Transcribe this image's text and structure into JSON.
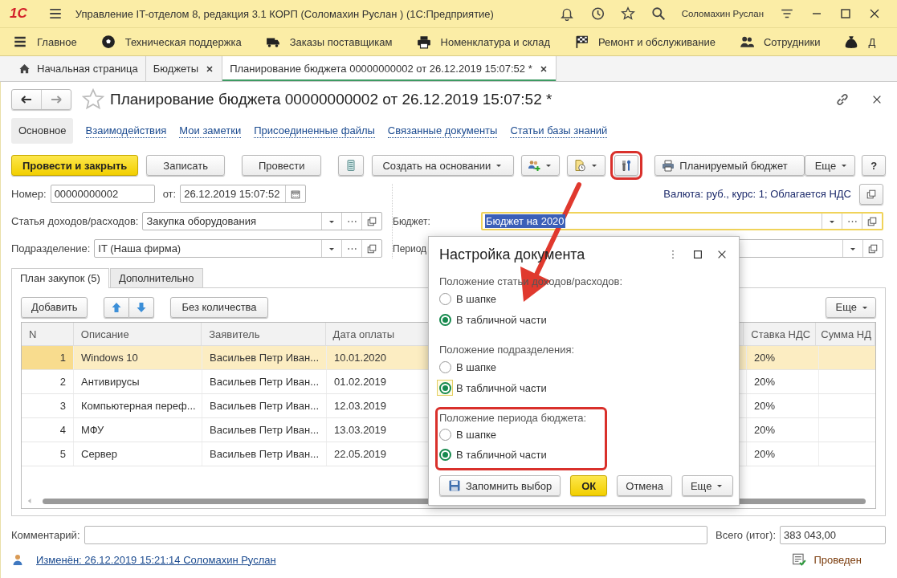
{
  "window": {
    "logo": "1С",
    "title": "Управление IT-отделом 8, редакция 3.1 КОРП (Соломахин Руслан )  (1С:Предприятие)",
    "user": "Соломахин Руслан"
  },
  "menu": [
    {
      "kind": "lines",
      "label": "Главное"
    },
    {
      "kind": "ball",
      "label": "Техническая поддержка"
    },
    {
      "kind": "truck",
      "label": "Заказы поставщикам"
    },
    {
      "kind": "printer",
      "label": "Номенклатура и склад"
    },
    {
      "kind": "flag",
      "label": "Ремонт и обслуживание"
    },
    {
      "kind": "people",
      "label": "Сотрудники"
    },
    {
      "kind": "bag",
      "label": "Д"
    }
  ],
  "tabs": [
    {
      "kind": "home",
      "label": "Начальная страница",
      "selected": false
    },
    {
      "kind": "closable",
      "label": "Бюджеты",
      "selected": false
    },
    {
      "kind": "closable",
      "label": "Планирование бюджета 00000000002 от 26.12.2019 15:07:52 *",
      "selected": true
    }
  ],
  "form": {
    "title": "Планирование бюджета 00000000002 от 26.12.2019 15:07:52 *",
    "sections": [
      {
        "label": "Основное",
        "selected": true
      },
      {
        "label": "Взаимодействия",
        "selected": false
      },
      {
        "label": "Мои заметки",
        "selected": false
      },
      {
        "label": "Присоединенные файлы",
        "selected": false
      },
      {
        "label": "Связанные документы",
        "selected": false
      },
      {
        "label": "Статьи базы знаний",
        "selected": false
      }
    ],
    "commands": [
      {
        "kind": "primary",
        "label": "Провести и закрыть",
        "highlighted": false
      },
      {
        "kind": "plain",
        "label": "Записать",
        "highlighted": false
      },
      {
        "kind": "plain",
        "label": "Провести",
        "highlighted": false
      },
      {
        "kind": "list",
        "highlighted": false
      },
      {
        "kind": "menu",
        "label": "Создать на основании",
        "highlighted": false
      },
      {
        "kind": "users",
        "highlighted": false
      },
      {
        "kind": "docs",
        "highlighted": false
      },
      {
        "kind": "tools",
        "highlighted": true
      },
      {
        "kind": "print",
        "label": "Планируемый бюджет",
        "highlighted": false
      },
      {
        "kind": "more",
        "label": "Еще",
        "highlighted": false
      },
      {
        "kind": "plain",
        "label": "?",
        "highlighted": false
      }
    ],
    "number": {
      "label": "Номер:",
      "value": "00000000002"
    },
    "date": {
      "label": "от:",
      "value": "26.12.2019 15:07:52"
    },
    "currency_note": "Валюта: руб., курс: 1; Облагается НДС",
    "item": {
      "label": "Статья доходов/расходов:",
      "value": "Закупка оборудования"
    },
    "budget": {
      "label": "Бюджет:",
      "value": "Бюджет на 2020",
      "focused": true
    },
    "department": {
      "label": "Подразделение:",
      "value": "IT (Наша фирма)"
    },
    "period": {
      "label": "Период"
    },
    "table_tabs": [
      {
        "label": "План закупок (5)",
        "selected": true
      },
      {
        "label": "Дополнительно",
        "selected": false
      }
    ],
    "table_buttons": [
      {
        "kind": "plain",
        "label": "Добавить"
      },
      {
        "kind": "up"
      },
      {
        "kind": "down"
      },
      {
        "kind": "plain",
        "label": "Без количества"
      },
      {
        "kind": "more",
        "label": "Еще"
      }
    ],
    "table": {
      "columns": [
        "N",
        "Описание",
        "Заявитель",
        "Дата оплаты",
        "Ставка НДС",
        "Сумма НД"
      ],
      "rows": [
        {
          "cells": [
            "1",
            "Windows 10",
            "Васильев Петр Иван...",
            "10.01.2020",
            "20%"
          ],
          "selected": true
        },
        {
          "cells": [
            "2",
            "Антивирусы",
            "Васильев Петр Иван...",
            "01.02.2019",
            "20%"
          ],
          "selected": false
        },
        {
          "cells": [
            "3",
            "Компьютерная переф...",
            "Васильев Петр Иван...",
            "12.03.2019",
            "20%"
          ],
          "selected": false
        },
        {
          "cells": [
            "4",
            "МФУ",
            "Васильев Петр Иван...",
            "13.03.2019",
            "20%"
          ],
          "selected": false
        },
        {
          "cells": [
            "5",
            "Сервер",
            "Васильев Петр Иван...",
            "22.05.2019",
            "20%"
          ],
          "selected": false
        }
      ]
    },
    "comment": {
      "label": "Комментарий:"
    },
    "total": {
      "label": "Всего (итог):",
      "value": "383 043,00"
    },
    "status": {
      "changed": "Изменён: 26.12.2019 15:21:14 Соломахин Руслан",
      "state": "Проведен"
    }
  },
  "dialog": {
    "title": "Настройка документа",
    "groups": [
      {
        "label": "Положение статьи доходов/расходов:",
        "highlighted": false,
        "options": [
          {
            "label": "В шапке",
            "selected": false,
            "focused": false
          },
          {
            "label": "В табличной части",
            "selected": true,
            "focused": false
          }
        ]
      },
      {
        "label": "Положение подразделения:",
        "highlighted": false,
        "options": [
          {
            "label": "В шапке",
            "selected": false,
            "focused": false
          },
          {
            "label": "В табличной части",
            "selected": true,
            "focused": true
          }
        ]
      },
      {
        "label": "Положение периода бюджета:",
        "highlighted": true,
        "options": [
          {
            "label": "В шапке",
            "selected": false,
            "focused": false
          },
          {
            "label": "В табличной части",
            "selected": true,
            "focused": false
          }
        ]
      }
    ],
    "buttons": [
      {
        "kind": "save",
        "label": "Запомнить выбор"
      },
      {
        "kind": "primary",
        "label": "ОК"
      },
      {
        "kind": "plain",
        "label": "Отмена"
      },
      {
        "kind": "more",
        "label": "Еще"
      }
    ]
  }
}
